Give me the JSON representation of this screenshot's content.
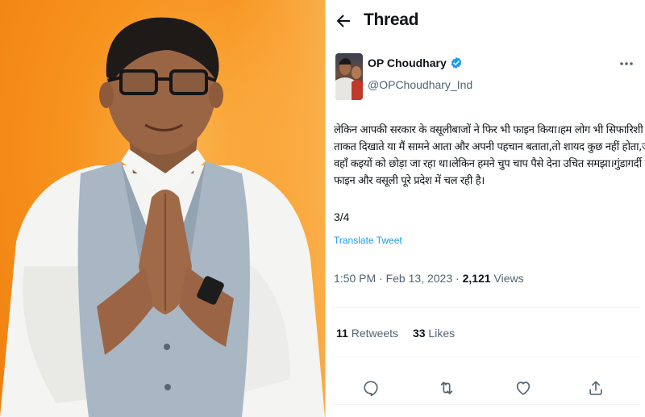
{
  "header": {
    "title": "Thread"
  },
  "tweet": {
    "author_name": "OP Choudhary",
    "author_handle": "@OPChoudhary_Ind",
    "text_lines": [
      "लेकिन आपकी सरकार के वसूलीबाजों ने फिर भी फाइन किया।हम लोग भी सिफारिशी",
      "ताकत दिखाते या मैं सामने आता और अपनी पहचान बताता,तो शायद कुछ नहीं होता,जैसे",
      "वहाँ कइयों को छोड़ा जा रहा था।लेकिन हमने चुप चाप पैसे देना उचित समझा।गुंडागर्दी से",
      "फाइन और वसूली पूरे प्रदेश में चल रही है।"
    ],
    "thread_position": "3/4",
    "translate_label": "Translate Tweet",
    "time": "1:50 PM",
    "separator": "·",
    "date": "Feb 13, 2023",
    "views_count": "2,121",
    "views_label": "Views",
    "retweets_count": "11",
    "retweets_label": "Retweets",
    "likes_count": "33",
    "likes_label": "Likes"
  },
  "icons": {
    "back": "arrow-left",
    "verified": "verified-badge",
    "more": "more-horizontal",
    "reply": "speech-bubble",
    "retweet": "retweet-arrows",
    "like": "heart",
    "share": "share-upload"
  },
  "colors": {
    "accent": "#1d9bf0",
    "text_primary": "#0f1419",
    "text_secondary": "#536471",
    "photo_background": "#f7931e"
  }
}
